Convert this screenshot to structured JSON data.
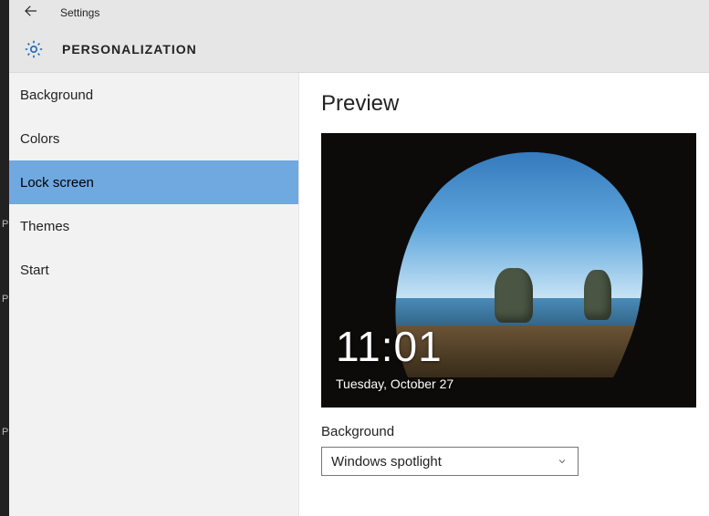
{
  "header": {
    "app_title": "Settings",
    "section_title": "PERSONALIZATION"
  },
  "sidebar": {
    "items": [
      {
        "label": "Background",
        "selected": false
      },
      {
        "label": "Colors",
        "selected": false
      },
      {
        "label": "Lock screen",
        "selected": true
      },
      {
        "label": "Themes",
        "selected": false
      },
      {
        "label": "Start",
        "selected": false
      }
    ]
  },
  "content": {
    "title": "Preview",
    "lockscreen": {
      "time": "11:01",
      "date": "Tuesday, October 27"
    },
    "background_label": "Background",
    "background_dropdown": {
      "selected": "Windows spotlight"
    }
  }
}
